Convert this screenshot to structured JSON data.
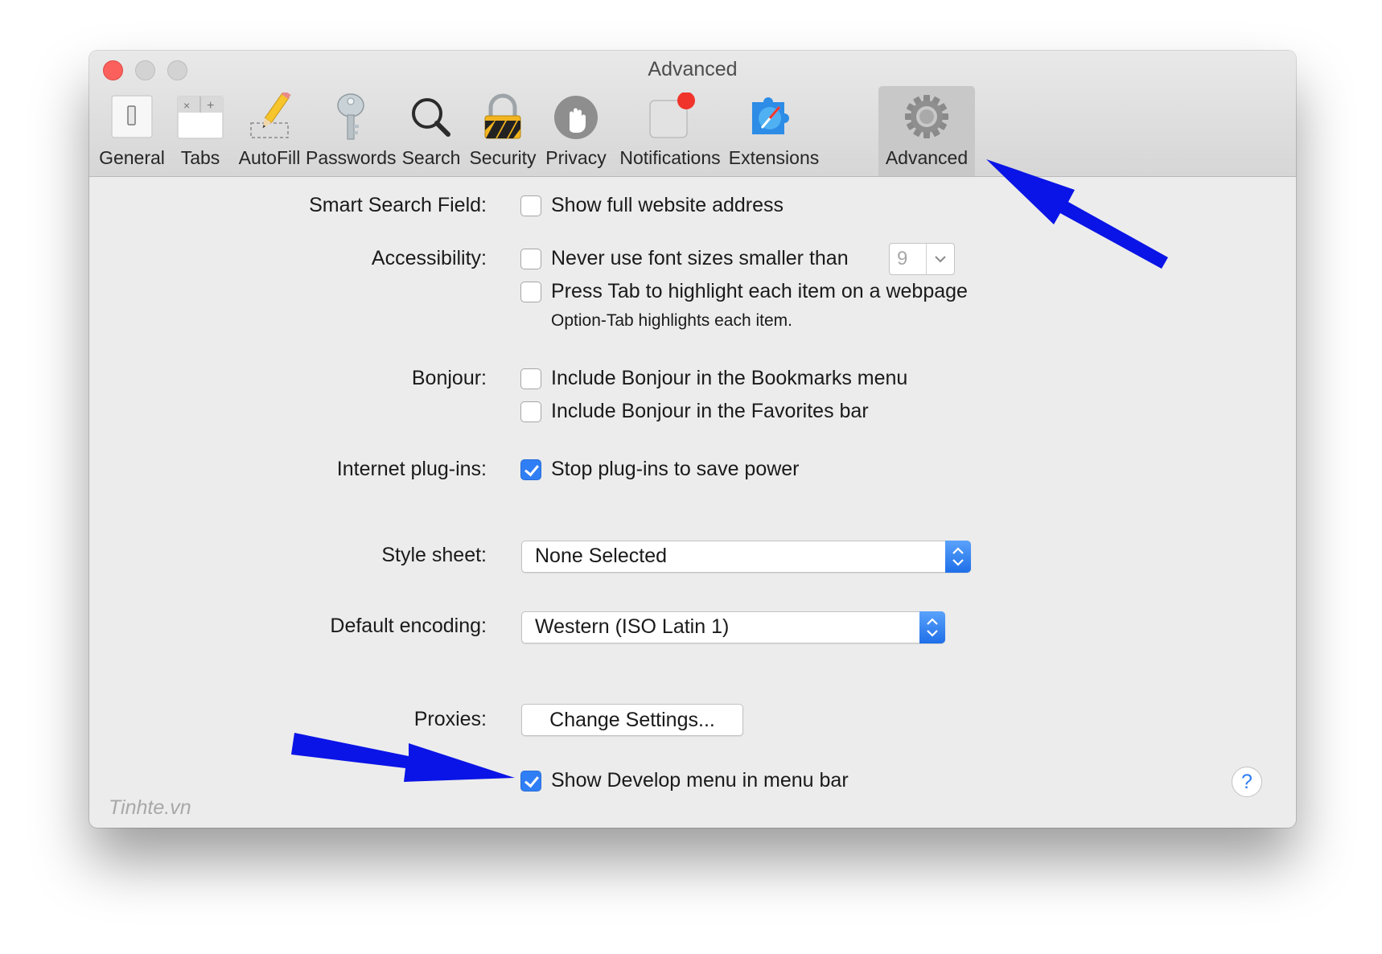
{
  "window": {
    "title": "Advanced"
  },
  "toolbar": {
    "items": [
      {
        "label": "General",
        "icon": "general-switch-icon"
      },
      {
        "label": "Tabs",
        "icon": "tabs-icon"
      },
      {
        "label": "AutoFill",
        "icon": "pencil-icon"
      },
      {
        "label": "Passwords",
        "icon": "key-icon"
      },
      {
        "label": "Search",
        "icon": "magnifier-icon"
      },
      {
        "label": "Security",
        "icon": "padlock-icon"
      },
      {
        "label": "Privacy",
        "icon": "hand-icon"
      },
      {
        "label": "Notifications",
        "icon": "notification-badge-icon"
      },
      {
        "label": "Extensions",
        "icon": "puzzle-compass-icon"
      },
      {
        "label": "Advanced",
        "icon": "gear-icon"
      }
    ],
    "selected": "Advanced"
  },
  "settings": {
    "smart_search": {
      "label": "Smart Search Field:",
      "option": "Show full website address",
      "checked": false
    },
    "accessibility": {
      "label": "Accessibility:",
      "font_size_option": "Never use font sizes smaller than",
      "font_size_checked": false,
      "font_size_value": "9",
      "tab_option": "Press Tab to highlight each item on a webpage",
      "tab_checked": false,
      "tab_note": "Option-Tab highlights each item."
    },
    "bonjour": {
      "label": "Bonjour:",
      "bookmarks_option": "Include Bonjour in the Bookmarks menu",
      "bookmarks_checked": false,
      "favorites_option": "Include Bonjour in the Favorites bar",
      "favorites_checked": false
    },
    "plugins": {
      "label": "Internet plug-ins:",
      "option": "Stop plug-ins to save power",
      "checked": true
    },
    "style_sheet": {
      "label": "Style sheet:",
      "value": "None Selected"
    },
    "encoding": {
      "label": "Default encoding:",
      "value": "Western (ISO Latin 1)"
    },
    "proxies": {
      "label": "Proxies:",
      "button": "Change Settings..."
    },
    "develop": {
      "option": "Show Develop menu in menu bar",
      "checked": true
    }
  },
  "help": {
    "label": "?"
  },
  "watermark": "Tinhte.vn",
  "colors": {
    "accent": "#2f7ef5",
    "annotation_arrow": "#0a14e6",
    "close": "#fc605c"
  }
}
